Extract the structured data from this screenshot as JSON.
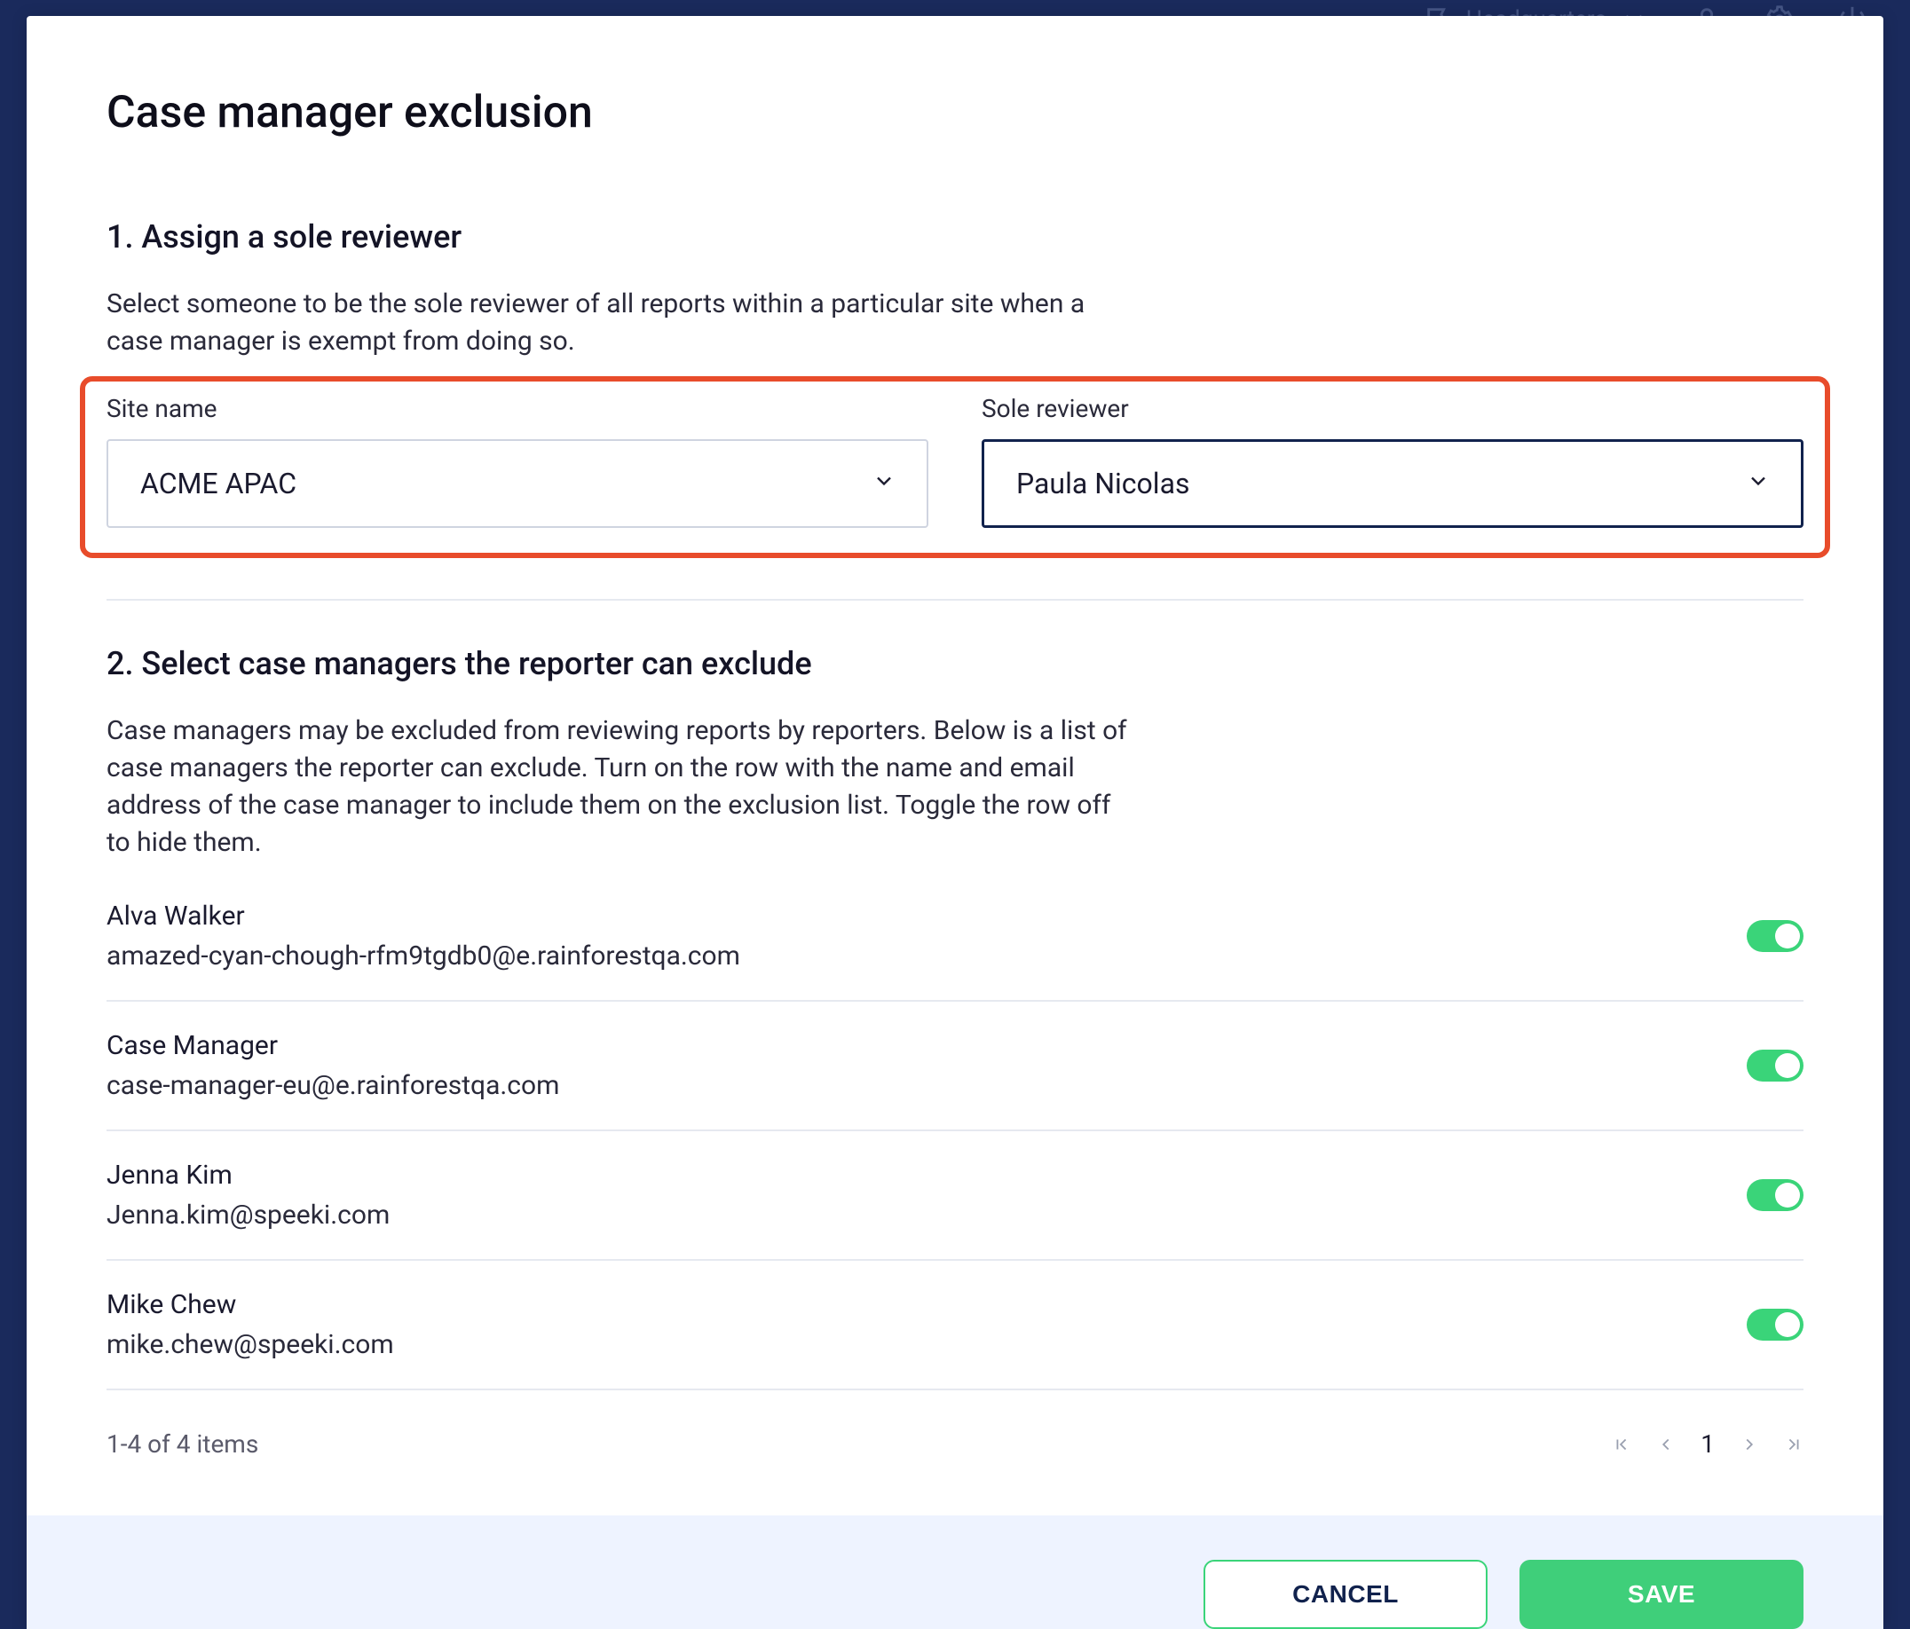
{
  "backdrop": {
    "location": "Headquarters"
  },
  "modal": {
    "title": "Case manager exclusion",
    "section1": {
      "title": "1. Assign a sole reviewer",
      "desc": "Select someone to be the sole reviewer of all reports within a particular site when a case manager is exempt from doing so.",
      "site_label": "Site name",
      "site_value": "ACME APAC",
      "reviewer_label": "Sole reviewer",
      "reviewer_value": "Paula Nicolas"
    },
    "section2": {
      "title": "2. Select case managers the reporter can exclude",
      "desc": "Case managers may be excluded from reviewing reports by reporters. Below is a list of case managers the reporter can exclude. Turn on the row with the name and email address of the case manager to include them on the exclusion list. Toggle the row off to hide them."
    },
    "managers": [
      {
        "name": "Alva Walker",
        "email": "amazed-cyan-chough-rfm9tgdb0@e.rainforestqa.com"
      },
      {
        "name": "Case Manager",
        "email": "case-manager-eu@e.rainforestqa.com"
      },
      {
        "name": "Jenna Kim",
        "email": "Jenna.kim@speeki.com"
      },
      {
        "name": "Mike Chew",
        "email": "mike.chew@speeki.com"
      }
    ],
    "pagination": {
      "summary": "1-4 of 4 items",
      "current": "1"
    },
    "buttons": {
      "cancel": "CANCEL",
      "save": "SAVE"
    }
  }
}
